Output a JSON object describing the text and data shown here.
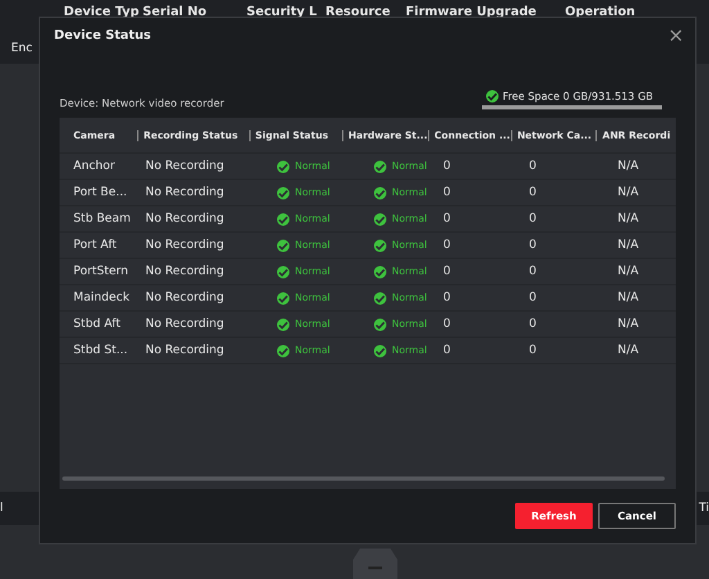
{
  "background": {
    "header_labels": [
      "Device Typ",
      "Serial No",
      "Security L",
      "Resource",
      "Firmware Upgrade",
      "Operation"
    ],
    "row_text": "Enc",
    "bottom_left": "l",
    "bottom_right": "Ti"
  },
  "dialog": {
    "title": "Device Status",
    "close": "×",
    "device_label": "Device: Network video recorder",
    "free_space": {
      "ok": true,
      "text": "Free Space 0 GB/931.513 GB",
      "level": 1
    },
    "table": {
      "columns": [
        "Camera",
        "Recording Status",
        "Signal Status",
        "Hardware St...",
        "Connection ...",
        "Network Ca...",
        "ANR Recordi"
      ],
      "rows": [
        {
          "camera": "Anchor",
          "recording": "No Recording",
          "signal": {
            "text": "Normal",
            "ok": true
          },
          "hardware": {
            "text": "Normal",
            "ok": true
          },
          "connection": "0",
          "network": "0",
          "anr": "N/A"
        },
        {
          "camera": "Port Be...",
          "recording": "No Recording",
          "signal": {
            "text": "Normal",
            "ok": true
          },
          "hardware": {
            "text": "Normal",
            "ok": true
          },
          "connection": "0",
          "network": "0",
          "anr": "N/A"
        },
        {
          "camera": "Stb Beam",
          "recording": "No Recording",
          "signal": {
            "text": "Normal",
            "ok": true
          },
          "hardware": {
            "text": "Normal",
            "ok": true
          },
          "connection": "0",
          "network": "0",
          "anr": "N/A"
        },
        {
          "camera": "Port Aft",
          "recording": "No Recording",
          "signal": {
            "text": "Normal",
            "ok": true
          },
          "hardware": {
            "text": "Normal",
            "ok": true
          },
          "connection": "0",
          "network": "0",
          "anr": "N/A"
        },
        {
          "camera": "PortStern",
          "recording": "No Recording",
          "signal": {
            "text": "Normal",
            "ok": true
          },
          "hardware": {
            "text": "Normal",
            "ok": true
          },
          "connection": "0",
          "network": "0",
          "anr": "N/A"
        },
        {
          "camera": "Maindeck",
          "recording": "No Recording",
          "signal": {
            "text": "Normal",
            "ok": true
          },
          "hardware": {
            "text": "Normal",
            "ok": true
          },
          "connection": "0",
          "network": "0",
          "anr": "N/A"
        },
        {
          "camera": "Stbd Aft",
          "recording": "No Recording",
          "signal": {
            "text": "Normal",
            "ok": true
          },
          "hardware": {
            "text": "Normal",
            "ok": true
          },
          "connection": "0",
          "network": "0",
          "anr": "N/A"
        },
        {
          "camera": "Stbd St...",
          "recording": "No Recording",
          "signal": {
            "text": "Normal",
            "ok": true
          },
          "hardware": {
            "text": "Normal",
            "ok": true
          },
          "connection": "0",
          "network": "0",
          "anr": "N/A"
        }
      ]
    },
    "buttons": [
      {
        "label": "Refresh",
        "kind": "primary"
      },
      {
        "label": "Cancel",
        "kind": "secondary"
      }
    ]
  }
}
